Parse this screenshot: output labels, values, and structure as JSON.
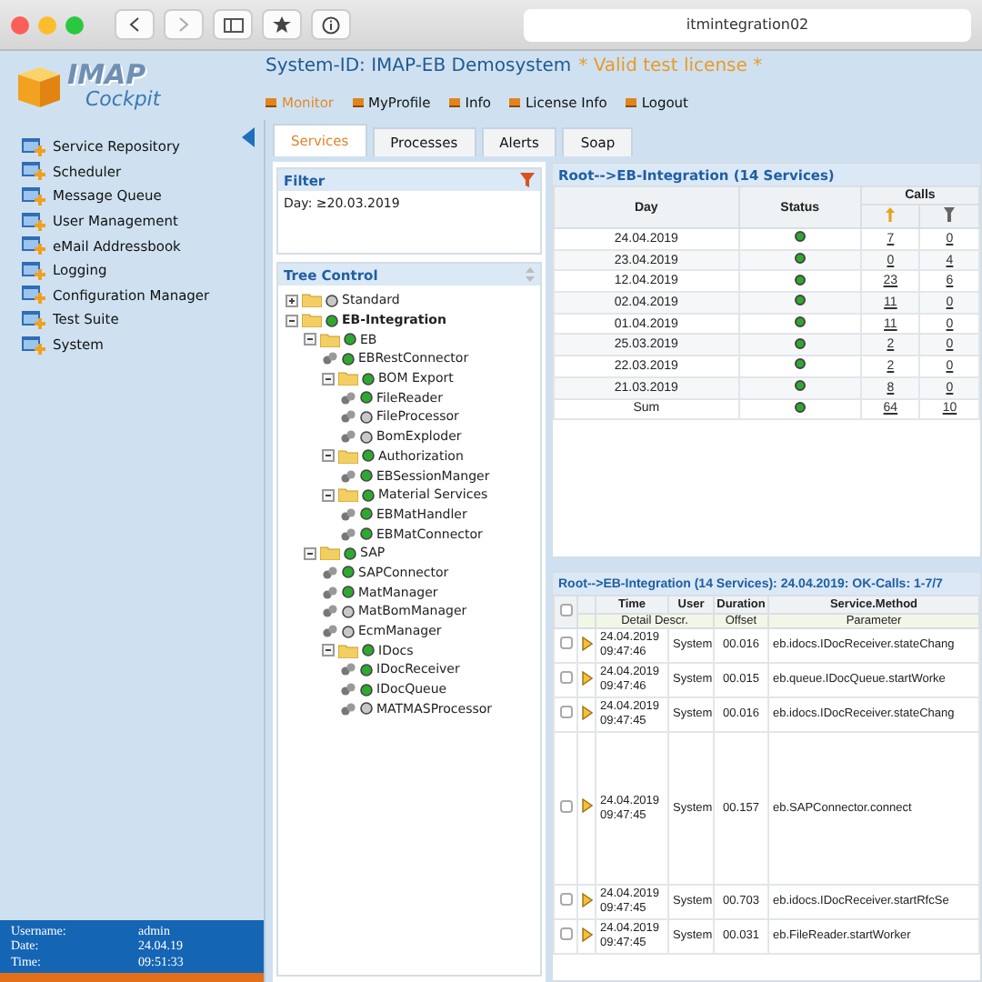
{
  "browser": {
    "url": "itmintegration02"
  },
  "logo": {
    "line_1": "IMAP",
    "line_2": "Cockpit"
  },
  "header": {
    "system_id": "System-ID: IMAP-EB Demosystem",
    "license": "* Valid test license *"
  },
  "menu": [
    {
      "label": "Monitor",
      "selected": true
    },
    {
      "label": "MyProfile",
      "selected": false
    },
    {
      "label": "Info",
      "selected": false
    },
    {
      "label": "License Info",
      "selected": false
    },
    {
      "label": "Logout",
      "selected": false
    }
  ],
  "sidebar": {
    "items": [
      {
        "label": "Service Repository"
      },
      {
        "label": "Scheduler"
      },
      {
        "label": "Message Queue"
      },
      {
        "label": "User Management"
      },
      {
        "label": "eMail Addressbook"
      },
      {
        "label": "Logging"
      },
      {
        "label": "Configuration Manager"
      },
      {
        "label": "Test Suite"
      },
      {
        "label": "System"
      }
    ]
  },
  "user_info": [
    {
      "label": "Username:",
      "value": "admin"
    },
    {
      "label": "Date:",
      "value": "24.04.19"
    },
    {
      "label": "Time:",
      "value": "09:51:33"
    }
  ],
  "tabs": [
    {
      "label": "Services",
      "selected": true
    },
    {
      "label": "Processes",
      "selected": false
    },
    {
      "label": "Alerts",
      "selected": false
    },
    {
      "label": "Soap",
      "selected": false
    }
  ],
  "filter": {
    "title": "Filter",
    "text": "Day:  ≥20.03.2019"
  },
  "tree": {
    "title": "Tree Control",
    "nodes": [
      {
        "kind": "folder",
        "label": "Standard",
        "color": "#c8c8c8",
        "expanded": false,
        "bold": false
      },
      {
        "kind": "folder",
        "label": "EB-Integration",
        "color": "#2fa82f",
        "expanded": true,
        "bold": true,
        "children": [
          {
            "kind": "folder",
            "label": "EB",
            "color": "#2fa82f",
            "expanded": true,
            "bold": false,
            "children": [
              {
                "kind": "service",
                "label": "EBRestConnector",
                "color": "#2fa82f"
              },
              {
                "kind": "folder",
                "label": "BOM Export",
                "color": "#2fa82f",
                "expanded": true,
                "bold": false,
                "children": [
                  {
                    "kind": "service",
                    "label": "FileReader",
                    "color": "#2fa82f"
                  },
                  {
                    "kind": "service",
                    "label": "FileProcessor",
                    "color": "#c8c8c8"
                  },
                  {
                    "kind": "service",
                    "label": "BomExploder",
                    "color": "#c8c8c8"
                  }
                ]
              },
              {
                "kind": "folder",
                "label": "Authorization",
                "color": "#2fa82f",
                "expanded": true,
                "bold": false,
                "children": [
                  {
                    "kind": "service",
                    "label": "EBSessionManger",
                    "color": "#2fa82f"
                  }
                ]
              },
              {
                "kind": "folder",
                "label": "Material Services",
                "color": "#2fa82f",
                "expanded": true,
                "bold": false,
                "children": [
                  {
                    "kind": "service",
                    "label": "EBMatHandler",
                    "color": "#2fa82f"
                  },
                  {
                    "kind": "service",
                    "label": "EBMatConnector",
                    "color": "#2fa82f"
                  }
                ]
              }
            ]
          },
          {
            "kind": "folder",
            "label": "SAP",
            "color": "#2fa82f",
            "expanded": true,
            "bold": false,
            "children": [
              {
                "kind": "service",
                "label": "SAPConnector",
                "color": "#2fa82f"
              },
              {
                "kind": "service",
                "label": "MatManager",
                "color": "#2fa82f"
              },
              {
                "kind": "service",
                "label": "MatBomManager",
                "color": "#c8c8c8"
              },
              {
                "kind": "service",
                "label": "EcmManager",
                "color": "#c8c8c8"
              },
              {
                "kind": "folder",
                "label": "IDocs",
                "color": "#2fa82f",
                "expanded": true,
                "bold": false,
                "children": [
                  {
                    "kind": "service",
                    "label": "IDocReceiver",
                    "color": "#2fa82f"
                  },
                  {
                    "kind": "service",
                    "label": "IDocQueue",
                    "color": "#2fa82f"
                  },
                  {
                    "kind": "service",
                    "label": "MATMASProcessor",
                    "color": "#c8c8c8"
                  }
                ]
              }
            ]
          }
        ]
      }
    ]
  },
  "services_table": {
    "title": "Root-->EB-Integration (14 Services)",
    "columns": [
      "Day",
      "Status",
      "Calls"
    ],
    "rows": [
      {
        "day": "24.04.2019",
        "color": "#2fa82f",
        "calls_ok": "7",
        "calls_error": "0"
      },
      {
        "day": "23.04.2019",
        "color": "#2fa82f",
        "calls_ok": "0",
        "calls_error": "4"
      },
      {
        "day": "12.04.2019",
        "color": "#2fa82f",
        "calls_ok": "23",
        "calls_error": "6"
      },
      {
        "day": "02.04.2019",
        "color": "#2fa82f",
        "calls_ok": "11",
        "calls_error": "0"
      },
      {
        "day": "01.04.2019",
        "color": "#2fa82f",
        "calls_ok": "11",
        "calls_error": "0"
      },
      {
        "day": "25.03.2019",
        "color": "#2fa82f",
        "calls_ok": "2",
        "calls_error": "0"
      },
      {
        "day": "22.03.2019",
        "color": "#2fa82f",
        "calls_ok": "2",
        "calls_error": "0"
      },
      {
        "day": "21.03.2019",
        "color": "#2fa82f",
        "calls_ok": "8",
        "calls_error": "0"
      },
      {
        "day": "Sum",
        "color": "#2fa82f",
        "calls_ok": "64",
        "calls_error": "10"
      }
    ]
  },
  "calls_table": {
    "title": "Root-->EB-Integration (14 Services): 24.04.2019: OK-Calls: 1-7/7",
    "columns": [
      "Time",
      "User",
      "Duration",
      "Service.Method"
    ],
    "subcolumns": [
      "Detail Descr.",
      "Offset",
      "Parameter"
    ],
    "all_checked": false,
    "rows": [
      {
        "checked": false,
        "date": "24.04.2019",
        "time": "09:47:46",
        "user": "System",
        "duration": "00.016",
        "method": "eb.idocs.IDocReceiver.stateChang",
        "tall": false
      },
      {
        "checked": false,
        "date": "24.04.2019",
        "time": "09:47:46",
        "user": "System",
        "duration": "00.015",
        "method": "eb.queue.IDocQueue.startWorke",
        "tall": false
      },
      {
        "checked": false,
        "date": "24.04.2019",
        "time": "09:47:45",
        "user": "System",
        "duration": "00.016",
        "method": "eb.idocs.IDocReceiver.stateChang",
        "tall": false
      },
      {
        "checked": false,
        "date": "24.04.2019",
        "time": "09:47:45",
        "user": "System",
        "duration": "00.157",
        "method": "eb.SAPConnector.connect",
        "tall": true
      },
      {
        "checked": false,
        "date": "24.04.2019",
        "time": "09:47:45",
        "user": "System",
        "duration": "00.703",
        "method": "eb.idocs.IDocReceiver.startRfcSe",
        "tall": false
      },
      {
        "checked": false,
        "date": "24.04.2019",
        "time": "09:47:45",
        "user": "System",
        "duration": "00.031",
        "method": "eb.FileReader.startWorker",
        "tall": false
      }
    ]
  }
}
